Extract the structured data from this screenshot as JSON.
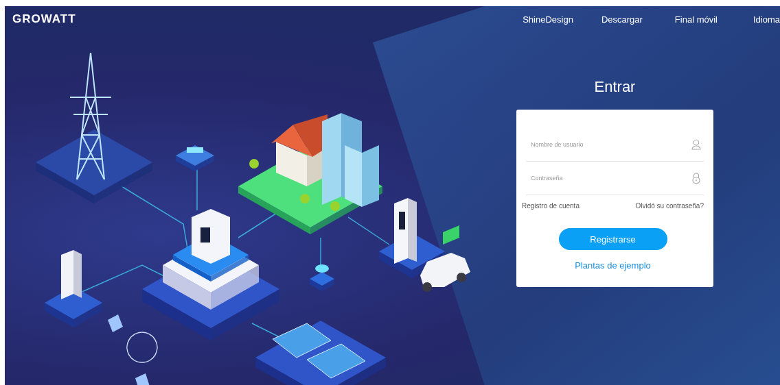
{
  "header": {
    "logo": "GROWATT",
    "nav": [
      {
        "label": "ShineDesign"
      },
      {
        "label": "Descargar"
      },
      {
        "label": "Final móvil"
      },
      {
        "label": "Idioma"
      }
    ]
  },
  "login": {
    "title": "Entrar",
    "fields": [
      {
        "kind": "user",
        "placeholder": "Nombre de usuario"
      },
      {
        "kind": "password",
        "placeholder": "Contraseña"
      }
    ],
    "register_link": "Registro de cuenta",
    "forgot_link": "Olvidó su contraseña?",
    "submit_button": "Registrarse",
    "demo_link": "Plantas de ejemplo"
  }
}
